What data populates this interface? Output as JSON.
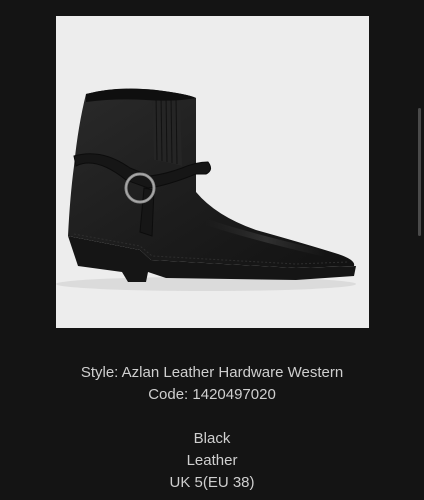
{
  "product": {
    "image_alt": "black leather western ankle boot with harness strap",
    "style_line": "Style: Azlan Leather Hardware Western",
    "code_line": "Code: 1420497020",
    "colour": "Black",
    "material": "Leather",
    "size": "UK 5(EU 38)"
  },
  "colors": {
    "background": "#141414",
    "image_background": "#ededed",
    "text": "#cfcfcf",
    "boot": "#1e1e1e"
  }
}
